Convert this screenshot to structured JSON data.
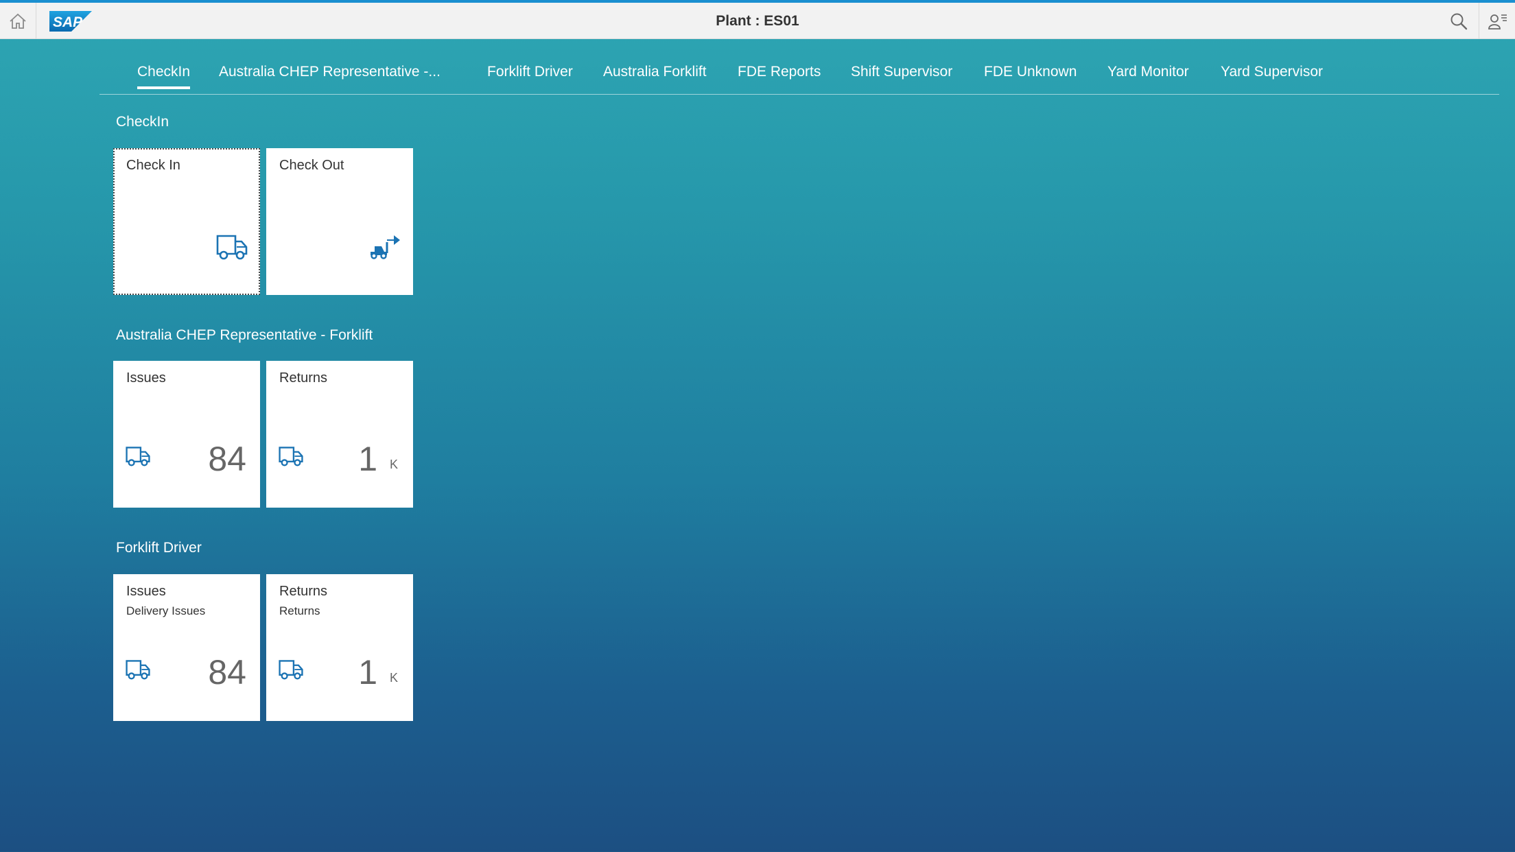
{
  "header": {
    "title": "Plant : ES01",
    "logo_text": "SAP",
    "accent_color": "#1a8fd0",
    "icons": [
      "home-icon",
      "search-icon",
      "user-menu-icon"
    ]
  },
  "tabs": [
    {
      "label": "CheckIn",
      "active": true
    },
    {
      "label": "Australia CHEP Representative -..."
    },
    {
      "label": "Forklift Driver"
    },
    {
      "label": "Australia Forklift"
    },
    {
      "label": "FDE Reports"
    },
    {
      "label": "Shift Supervisor"
    },
    {
      "label": "FDE Unknown"
    },
    {
      "label": "Yard Monitor"
    },
    {
      "label": "Yard Supervisor"
    }
  ],
  "groups": [
    {
      "title": "CheckIn",
      "tiles": [
        {
          "title": "Check In",
          "icon": "truck-icon"
        },
        {
          "title": "Check Out",
          "icon": "truck-exit-icon"
        }
      ]
    },
    {
      "title": "Australia CHEP Representative - Forklift",
      "tiles": [
        {
          "title": "Issues",
          "icon": "truck-icon",
          "number": "84"
        },
        {
          "title": "Returns",
          "icon": "truck-icon",
          "number": "1",
          "unit": "K"
        }
      ]
    },
    {
      "title": "Forklift Driver",
      "tiles": [
        {
          "title": "Issues",
          "subtitle": "Delivery Issues",
          "icon": "truck-icon",
          "number": "84"
        },
        {
          "title": "Returns",
          "subtitle": "Returns",
          "icon": "truck-icon",
          "number": "1",
          "unit": "K"
        }
      ]
    }
  ]
}
